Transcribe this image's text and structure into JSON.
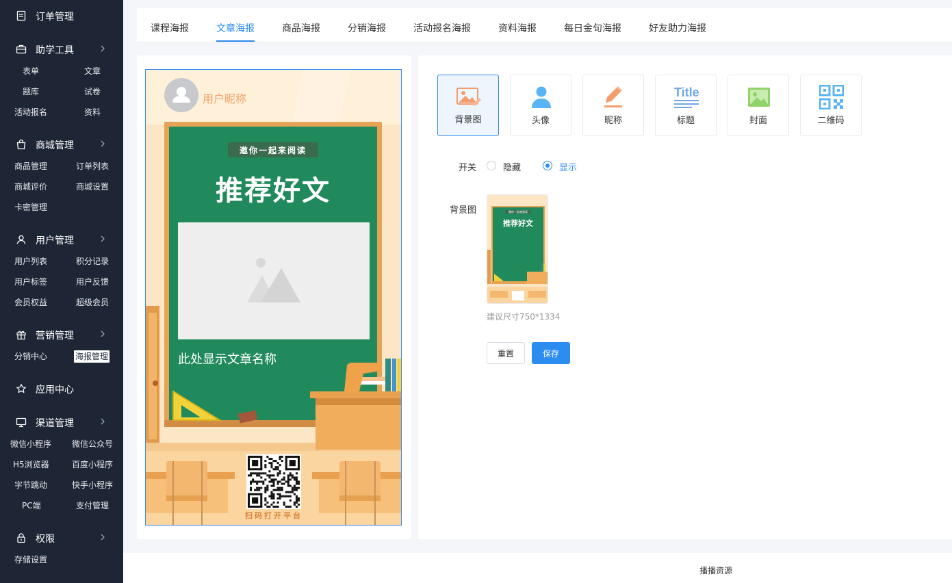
{
  "sidebar": {
    "sections": [
      {
        "label": "订单管理",
        "icon": "document-icon",
        "expandable": false
      },
      {
        "label": "助学工具",
        "icon": "briefcase-icon",
        "expandable": true,
        "items": [
          "表单",
          "文章",
          "题库",
          "试卷",
          "活动报名",
          "资料"
        ]
      },
      {
        "label": "商城管理",
        "icon": "shopping-bag-icon",
        "expandable": true,
        "items": [
          "商品管理",
          "订单列表",
          "商城评价",
          "商城设置",
          "卡密管理"
        ]
      },
      {
        "label": "用户管理",
        "icon": "user-icon",
        "expandable": true,
        "items": [
          "用户列表",
          "积分记录",
          "用户标签",
          "用户反馈",
          "会员权益",
          "超级会员"
        ]
      },
      {
        "label": "营销管理",
        "icon": "gift-icon",
        "expandable": true,
        "items": [
          "分销中心",
          "海报管理"
        ]
      },
      {
        "label": "应用中心",
        "icon": "star-icon",
        "expandable": false
      },
      {
        "label": "渠道管理",
        "icon": "monitor-icon",
        "expandable": true,
        "items": [
          "微信小程序",
          "微信公众号",
          "H5浏览器",
          "百度小程序",
          "字节跳动",
          "快手小程序",
          "PC端",
          "支付管理"
        ]
      },
      {
        "label": "权限",
        "icon": "lock-icon",
        "expandable": true,
        "items": [
          "存储设置"
        ]
      }
    ],
    "active_item": "海报管理"
  },
  "tabs": [
    "课程海报",
    "文章海报",
    "商品海报",
    "分销海报",
    "活动报名海报",
    "资料海报",
    "每日金句海报",
    "好友助力海报"
  ],
  "active_tab": "文章海报",
  "poster": {
    "nickname": "用户昵称",
    "banner": "邀你一起来阅读",
    "headline": "推荐好文",
    "article_title": "此处显示文章名称",
    "qr_caption": "扫码打开平台"
  },
  "tools": [
    {
      "label": "背景图",
      "icon": "background-image-icon"
    },
    {
      "label": "头像",
      "icon": "avatar-icon"
    },
    {
      "label": "昵称",
      "icon": "pencil-icon"
    },
    {
      "label": "标题",
      "icon": "title-icon",
      "icon_text": "Title"
    },
    {
      "label": "封面",
      "icon": "cover-image-icon"
    },
    {
      "label": "二维码",
      "icon": "qrcode-icon"
    }
  ],
  "active_tool": "背景图",
  "form": {
    "switch_label": "开关",
    "option_hide": "隐藏",
    "option_show": "显示",
    "selected": "显示",
    "bg_label": "背景图",
    "thumb_banner": "邀你一起来阅读",
    "thumb_headline": "推荐好文",
    "size_hint": "建议尺寸750*1334",
    "reset_button": "重置",
    "save_button": "保存"
  },
  "footer": {
    "text": "播播资源"
  },
  "colors": {
    "accent": "#2d8cf0",
    "sidebar_bg": "#1e2635",
    "chalkboard": "#218a5c",
    "poster_bg": "#fde5c3"
  }
}
